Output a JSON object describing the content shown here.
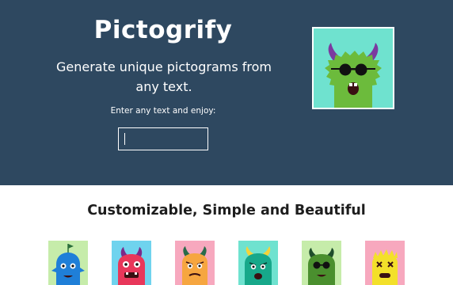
{
  "hero": {
    "title": "Pictogrify",
    "tagline": "Generate unique pictograms from any text.",
    "prompt": "Enter any text and enjoy:",
    "input_value": "",
    "background_color": "#2e4860"
  },
  "preview": {
    "icon": "green-monster-sunglasses-pictogram",
    "background_color": "#6fe2cf"
  },
  "features": {
    "title": "Customizable, Simple and Beautiful"
  },
  "gallery": [
    {
      "icon": "blue-monster-flag-pictogram",
      "background_color": "#c6ecaa"
    },
    {
      "icon": "red-monster-horns-pictogram",
      "background_color": "#6fd3ee"
    },
    {
      "icon": "orange-monster-horns-pictogram",
      "background_color": "#f7a8be"
    },
    {
      "icon": "teal-monster-yellow-horns-pictogram",
      "background_color": "#6fe2cf"
    },
    {
      "icon": "green-monster-sunglasses-pictogram",
      "background_color": "#c6ecaa"
    },
    {
      "icon": "yellow-monster-spikes-pictogram",
      "background_color": "#f7a8be"
    }
  ]
}
